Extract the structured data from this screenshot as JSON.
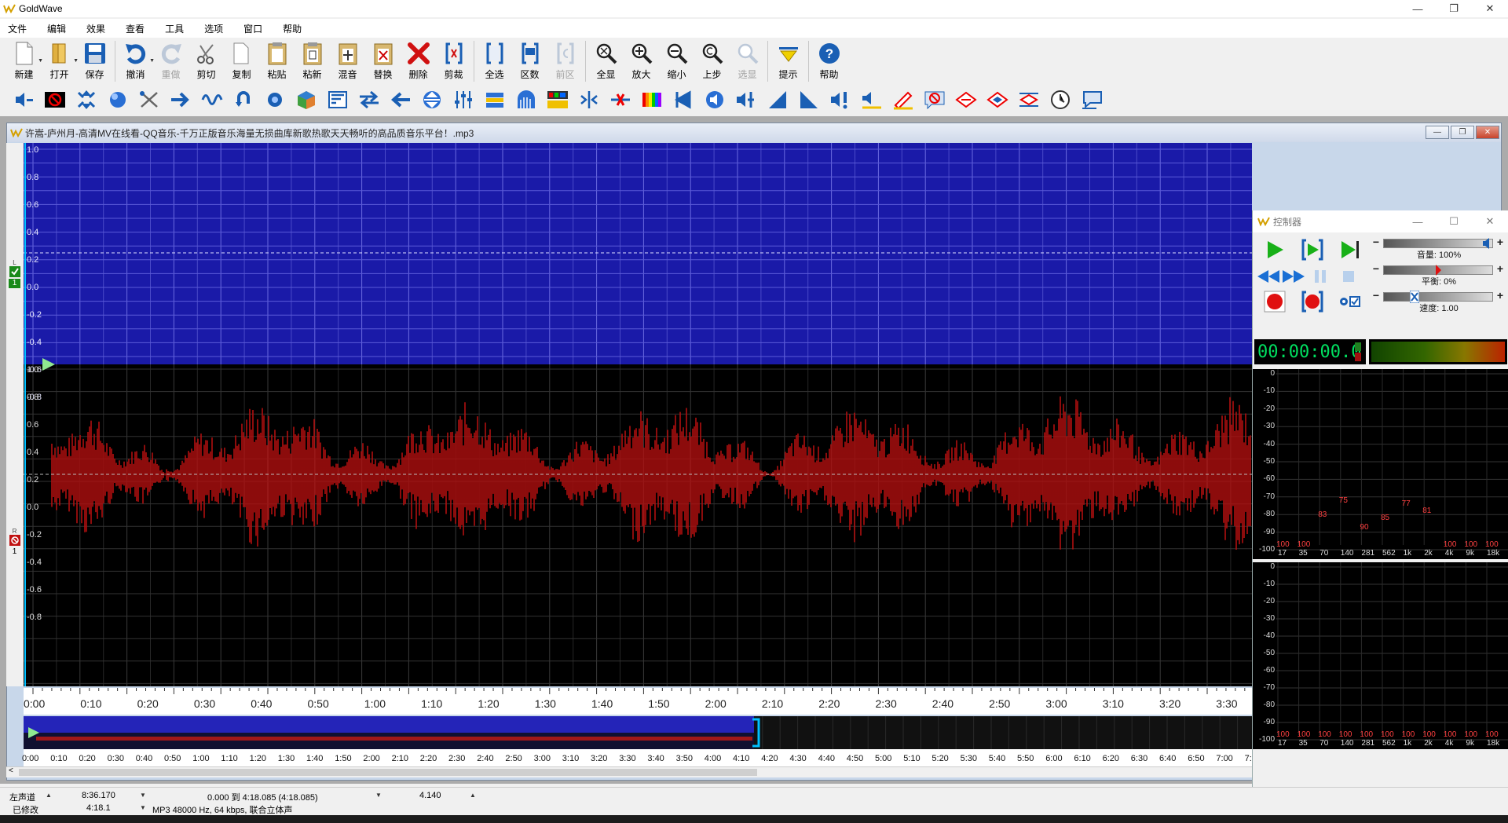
{
  "window": {
    "title": "GoldWave",
    "controls": [
      "—",
      "❐",
      "✕"
    ]
  },
  "menu": [
    "文件",
    "编辑",
    "效果",
    "查看",
    "工具",
    "选项",
    "窗口",
    "帮助"
  ],
  "toolbar": {
    "buttons": [
      {
        "label": "新建",
        "icon": "new-file-icon"
      },
      {
        "label": "打开",
        "icon": "open-folder-icon"
      },
      {
        "label": "保存",
        "icon": "save-disk-icon"
      },
      {
        "label": "撤消",
        "icon": "undo-icon"
      },
      {
        "label": "重做",
        "icon": "redo-icon",
        "disabled": true
      },
      {
        "label": "剪切",
        "icon": "cut-scissors-icon"
      },
      {
        "label": "复制",
        "icon": "copy-icon"
      },
      {
        "label": "粘贴",
        "icon": "paste-icon"
      },
      {
        "label": "粘新",
        "icon": "paste-new-icon"
      },
      {
        "label": "混音",
        "icon": "mix-icon"
      },
      {
        "label": "替换",
        "icon": "replace-icon"
      },
      {
        "label": "删除",
        "icon": "delete-x-icon"
      },
      {
        "label": "剪裁",
        "icon": "trim-icon"
      },
      {
        "label": "全选",
        "icon": "select-all-icon"
      },
      {
        "label": "区数",
        "icon": "region-count-icon"
      },
      {
        "label": "前区",
        "icon": "previous-region-icon",
        "disabled": true
      },
      {
        "label": "全显",
        "icon": "zoom-all-icon"
      },
      {
        "label": "放大",
        "icon": "zoom-in-icon"
      },
      {
        "label": "缩小",
        "icon": "zoom-out-icon"
      },
      {
        "label": "上步",
        "icon": "zoom-previous-icon"
      },
      {
        "label": "选显",
        "icon": "zoom-selection-icon",
        "disabled": true
      },
      {
        "label": "提示",
        "icon": "cue-icon"
      },
      {
        "label": "帮助",
        "icon": "help-icon"
      }
    ],
    "effects_count": 34
  },
  "document": {
    "title": "许嵩-庐州月-高清MV在线看-QQ音乐-千万正版音乐海量无损曲库新歌热歌天天畅听的高品质音乐平台！.mp3",
    "y_labels_top": [
      "1.0",
      "0.8",
      "0.6",
      "0.4",
      "0.2",
      "0.0",
      "-0.2",
      "-0.4",
      "-0.6",
      "-0.8"
    ],
    "y_labels_bottom": [
      "1.0",
      "0.8",
      "0.6",
      "0.4",
      "0.2",
      "0.0",
      "-0.2",
      "-0.4",
      "-0.6",
      "-0.8"
    ],
    "left_channel_label": "L",
    "right_channel_label": "R",
    "channel_number": "1",
    "timeline": [
      "0:00",
      "0:10",
      "0:20",
      "0:30",
      "0:40",
      "0:50",
      "1:00",
      "1:10",
      "1:20",
      "1:30",
      "1:40",
      "1:50",
      "2:00",
      "2:10",
      "2:20",
      "2:30",
      "2:40",
      "2:50",
      "3:00",
      "3:10",
      "3:20",
      "3:30"
    ],
    "overview_scale": [
      "0:00",
      "0:10",
      "0:20",
      "0:30",
      "0:40",
      "0:50",
      "1:00",
      "1:10",
      "1:20",
      "1:30",
      "1:40",
      "1:50",
      "2:00",
      "2:10",
      "2:20",
      "2:30",
      "2:40",
      "2:50",
      "3:00",
      "3:10",
      "3:20",
      "3:30",
      "3:40",
      "3:50",
      "4:00",
      "4:10",
      "4:20",
      "4:30",
      "4:40",
      "4:50",
      "5:00",
      "5:10",
      "5:20",
      "5:30",
      "5:40",
      "5:50",
      "6:00",
      "6:10",
      "6:20",
      "6:30",
      "6:40",
      "6:50",
      "7:00",
      "7:"
    ]
  },
  "controller": {
    "title": "控制器",
    "volume_label": "音量: 100%",
    "balance_label": "平衡: 0%",
    "speed_label": "速度: 1.00",
    "time": "00:00:00.0",
    "db_labels": [
      "0",
      "-10",
      "-20",
      "-30",
      "-40",
      "-50",
      "-60",
      "-70",
      "-80",
      "-90",
      "-100"
    ],
    "freq_labels": [
      "17",
      "35",
      "70",
      "140",
      "281",
      "562",
      "1k",
      "2k",
      "4k",
      "9k",
      "18k"
    ],
    "top_values": [
      "100",
      "100",
      "83",
      "75",
      "90",
      "85",
      "77",
      "81",
      "100",
      "100",
      "100"
    ],
    "bottom_values": [
      "100",
      "100",
      "100",
      "100",
      "100",
      "100",
      "100",
      "100",
      "100",
      "100",
      "100"
    ]
  },
  "status": {
    "channel": "左声道",
    "total_length": "8:36.170",
    "selection": "0.000 到 4:18.085 (4:18.085)",
    "zoom": "4.140",
    "state": "已修改",
    "file_length": "4:18.1",
    "format": "MP3 48000 Hz, 64 kbps, 联合立体声"
  },
  "colors": {
    "wave_top_bg": "#1a1aa8",
    "wave_bottom_bg": "#000000",
    "wave_color": "#b01010",
    "grid": "#8888cc",
    "time_green": "#00e060"
  }
}
